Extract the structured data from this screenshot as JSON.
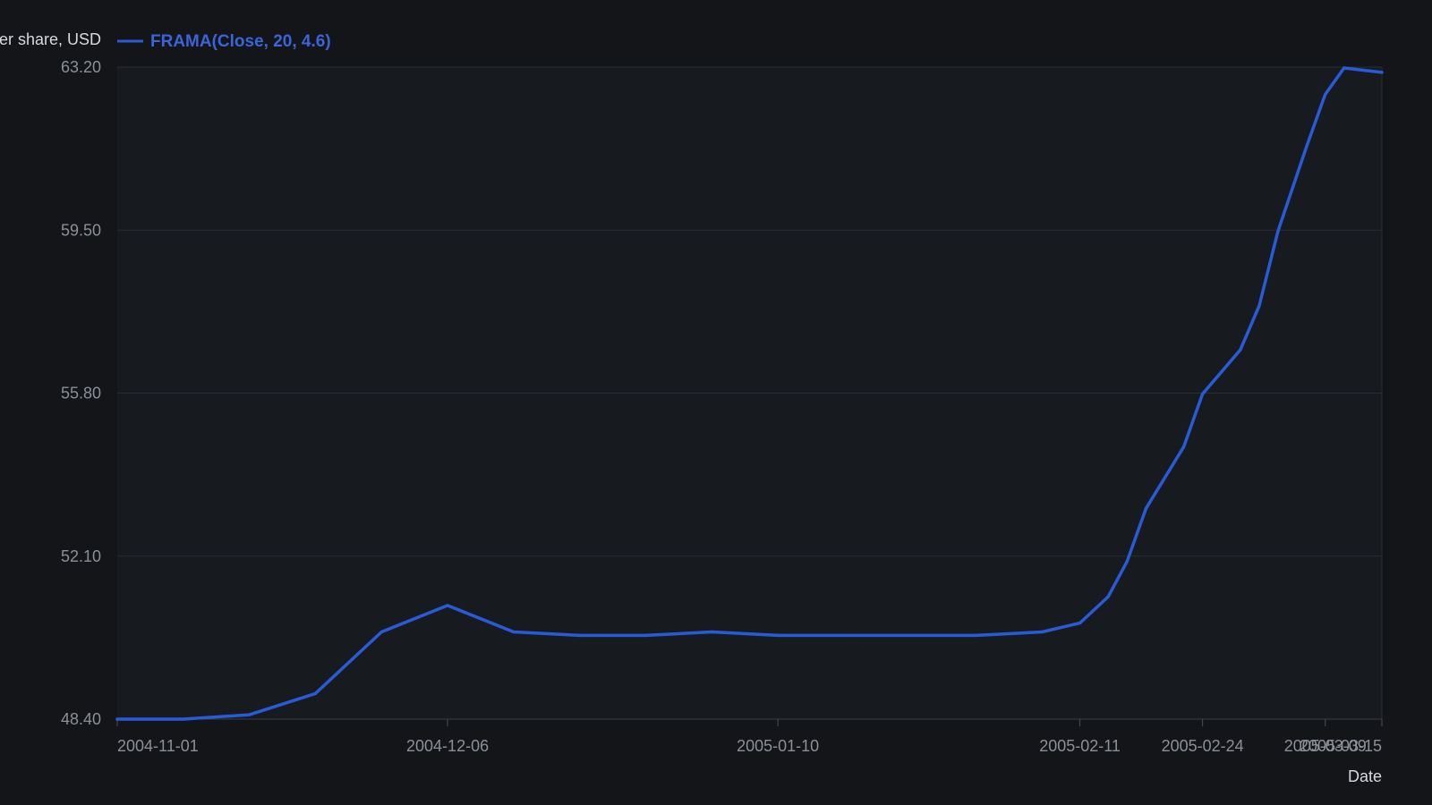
{
  "chart_data": {
    "type": "line",
    "ylabel": "Price per share, USD",
    "xlabel": "Date",
    "ylim": [
      48.4,
      63.2
    ],
    "y_ticks": [
      "48.40",
      "52.10",
      "55.80",
      "59.50",
      "63.20"
    ],
    "x_ticks": [
      "2004-11-01",
      "2004-12-06",
      "2005-01-10",
      "2005-02-11",
      "2005-02-24",
      "2005-03-09",
      "2005-03-15"
    ],
    "grid": "horizontal",
    "legend_placement": "top",
    "series": [
      {
        "name": "FRAMA(Close, 20, 4.6)",
        "color": "#2a5bd7",
        "points": [
          [
            "2004-11-01",
            48.4
          ],
          [
            "2004-11-08",
            48.4
          ],
          [
            "2004-11-15",
            48.5
          ],
          [
            "2004-11-22",
            48.98
          ],
          [
            "2004-11-29",
            50.38
          ],
          [
            "2004-12-06",
            50.98
          ],
          [
            "2004-12-13",
            50.38
          ],
          [
            "2004-12-20",
            50.3
          ],
          [
            "2004-12-27",
            50.3
          ],
          [
            "2005-01-03",
            50.38
          ],
          [
            "2005-01-10",
            50.3
          ],
          [
            "2005-01-17",
            50.3
          ],
          [
            "2005-01-24",
            50.3
          ],
          [
            "2005-01-31",
            50.3
          ],
          [
            "2005-02-07",
            50.38
          ],
          [
            "2005-02-11",
            50.58
          ],
          [
            "2005-02-14",
            51.18
          ],
          [
            "2005-02-16",
            51.98
          ],
          [
            "2005-02-18",
            53.18
          ],
          [
            "2005-02-22",
            54.58
          ],
          [
            "2005-02-24",
            55.78
          ],
          [
            "2005-02-28",
            56.78
          ],
          [
            "2005-03-02",
            57.78
          ],
          [
            "2005-03-04",
            59.48
          ],
          [
            "2005-03-07",
            61.38
          ],
          [
            "2005-03-09",
            62.58
          ],
          [
            "2005-03-11",
            63.18
          ],
          [
            "2005-03-15",
            63.08
          ]
        ]
      }
    ]
  }
}
